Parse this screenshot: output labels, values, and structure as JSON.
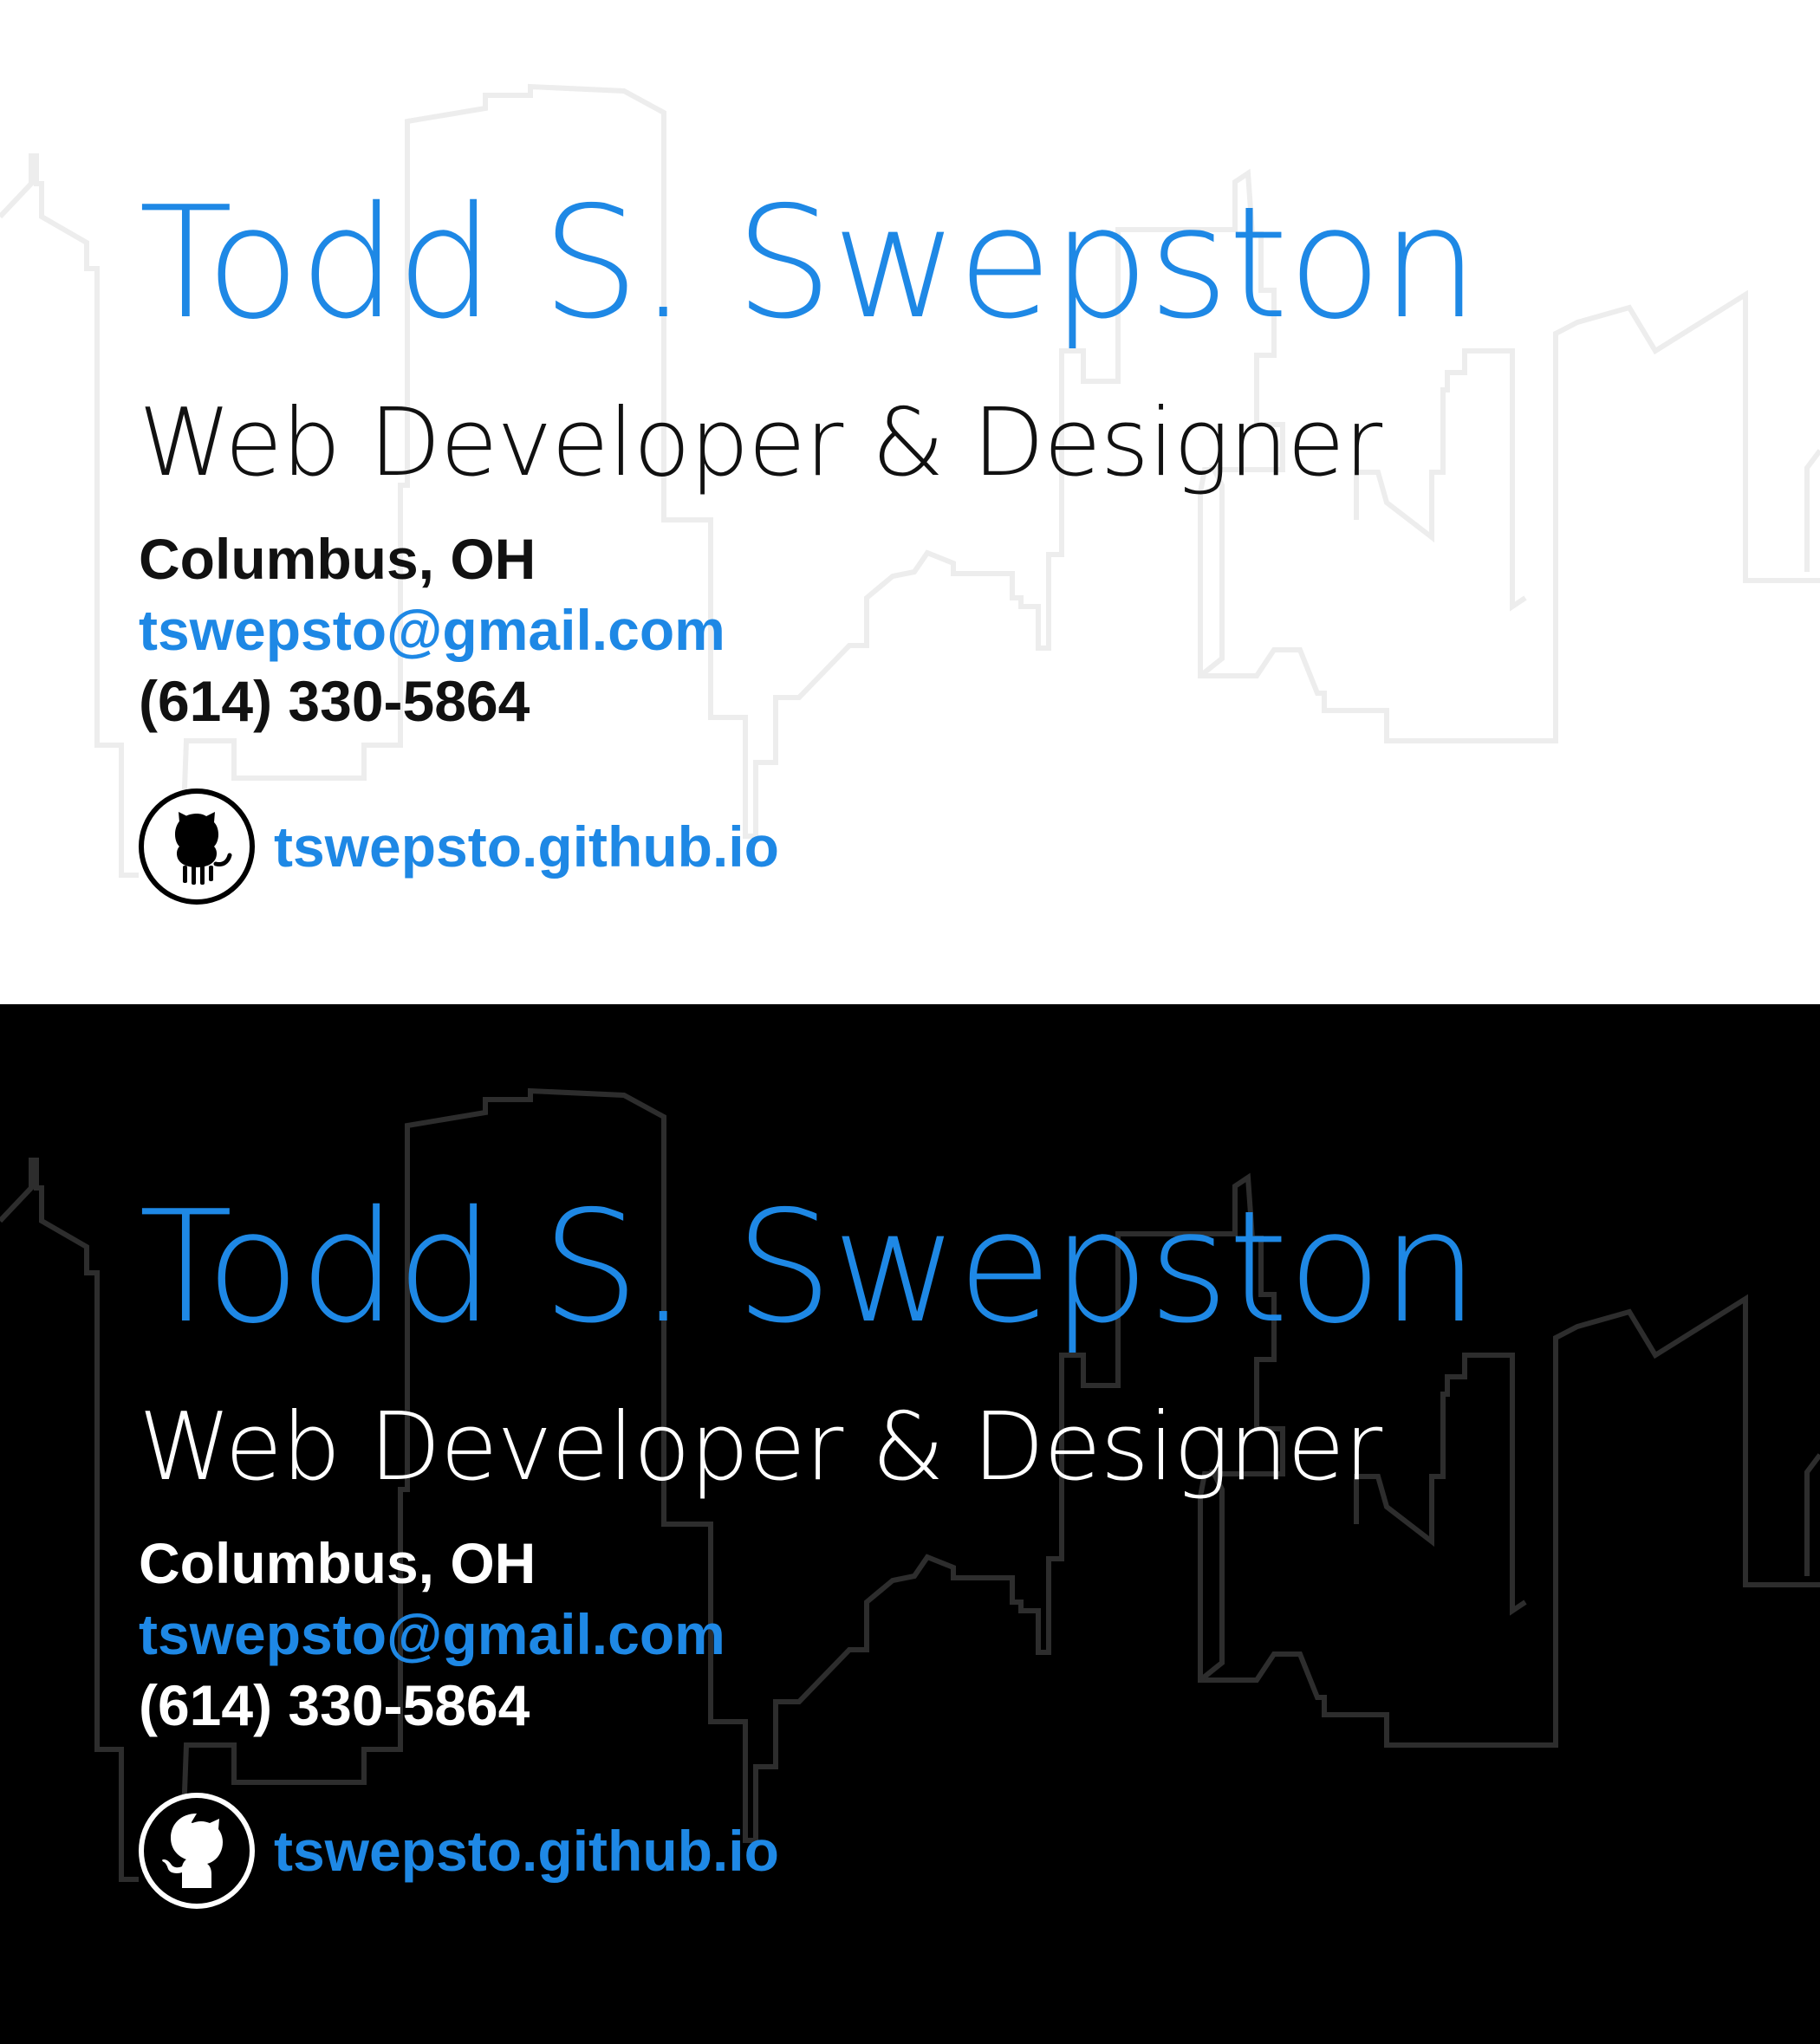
{
  "colors": {
    "accent": "#1e88e5",
    "light_background": "#ffffff",
    "dark_background": "#000000",
    "light_skyline": "#ededed",
    "dark_skyline": "#2d2d2d"
  },
  "cards": [
    {
      "theme": "light",
      "name": "Todd S. Swepston",
      "title": "Web Developer & Designer",
      "location": "Columbus, OH",
      "email": "tswepsto@gmail.com",
      "phone": "(614) 330-5864",
      "website": "tswepsto.github.io",
      "website_icon": "github-octocat-icon"
    },
    {
      "theme": "dark",
      "name": "Todd S. Swepston",
      "title": "Web Developer & Designer",
      "location": "Columbus, OH",
      "email": "tswepsto@gmail.com",
      "phone": "(614) 330-5864",
      "website": "tswepsto.github.io",
      "website_icon": "github-octocat-icon"
    }
  ]
}
